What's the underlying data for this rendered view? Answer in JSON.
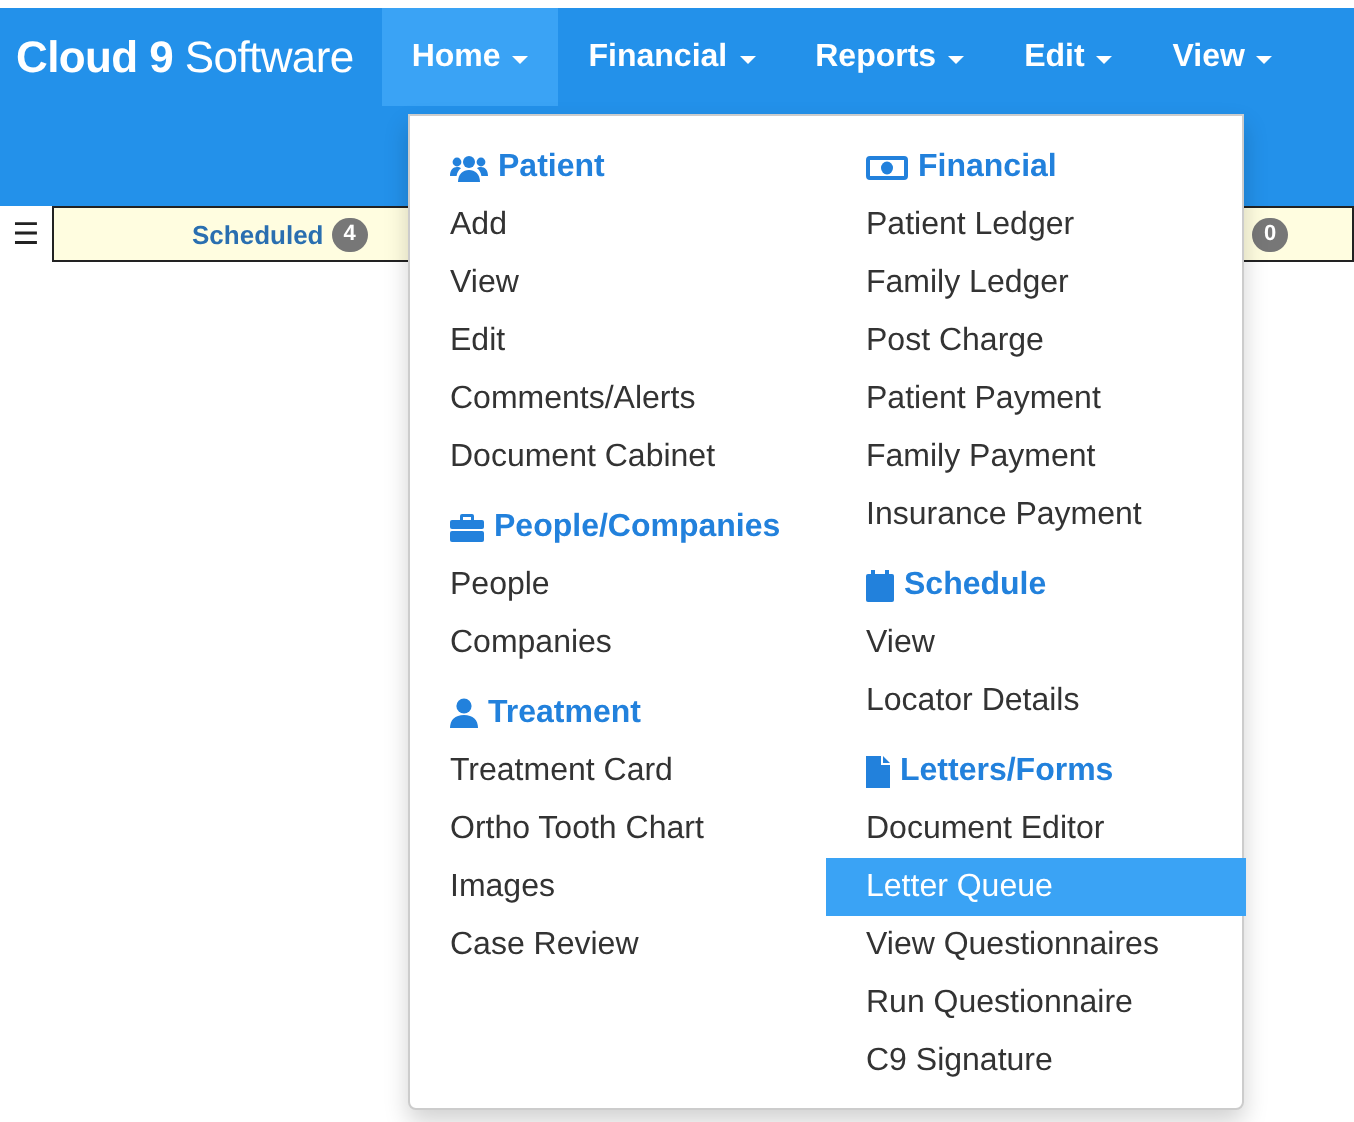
{
  "brand": "**Cloud 9** Software",
  "nav": [
    {
      "label": "Home",
      "selected": true
    },
    {
      "label": "Financial",
      "selected": false
    },
    {
      "label": "Reports",
      "selected": false
    },
    {
      "label": "Edit",
      "selected": false
    },
    {
      "label": "View",
      "selected": false
    }
  ],
  "menu_button": "☰",
  "status_bar": [
    {
      "label": "Scheduled",
      "count": "4"
    },
    {
      "count": "0"
    }
  ],
  "dropdown": {
    "columns": [
      [
        {
          "kind": "patient",
          "title": "Patient",
          "items": [
            {
              "label": "Add",
              "selected": false
            },
            {
              "label": "View",
              "selected": false
            },
            {
              "label": "Edit",
              "selected": false
            },
            {
              "label": "Comments/Alerts",
              "selected": false
            },
            {
              "label": "Document Cabinet",
              "selected": false
            }
          ]
        },
        {
          "kind": "companies",
          "title": "People/Companies",
          "items": [
            {
              "label": "People",
              "selected": false
            },
            {
              "label": "Companies",
              "selected": false
            }
          ]
        },
        {
          "kind": "treatment",
          "title": "Treatment",
          "items": [
            {
              "label": "Treatment Card",
              "selected": false
            },
            {
              "label": "Ortho Tooth Chart",
              "selected": false
            },
            {
              "label": "Images",
              "selected": false
            },
            {
              "label": "Case Review",
              "selected": false
            }
          ]
        }
      ],
      [
        {
          "kind": "financial",
          "title": "Financial",
          "items": [
            {
              "label": "Patient Ledger",
              "selected": false
            },
            {
              "label": "Family Ledger",
              "selected": false
            },
            {
              "label": "Post Charge",
              "selected": false
            },
            {
              "label": "Patient Payment",
              "selected": false
            },
            {
              "label": "Family Payment",
              "selected": false
            },
            {
              "label": "Insurance Payment",
              "selected": false
            }
          ]
        },
        {
          "kind": "schedule",
          "title": "Schedule",
          "items": [
            {
              "label": "View",
              "selected": false
            },
            {
              "label": "Locator Details",
              "selected": false
            }
          ]
        },
        {
          "kind": "letters",
          "title": "Letters/Forms",
          "items": [
            {
              "label": "Document Editor",
              "selected": false
            },
            {
              "label": "Letter Queue",
              "selected": true
            },
            {
              "label": "View Questionnaires",
              "selected": false
            },
            {
              "label": "Run Questionnaire",
              "selected": false
            },
            {
              "label": "C9 Signature",
              "selected": false
            }
          ]
        }
      ]
    ]
  }
}
